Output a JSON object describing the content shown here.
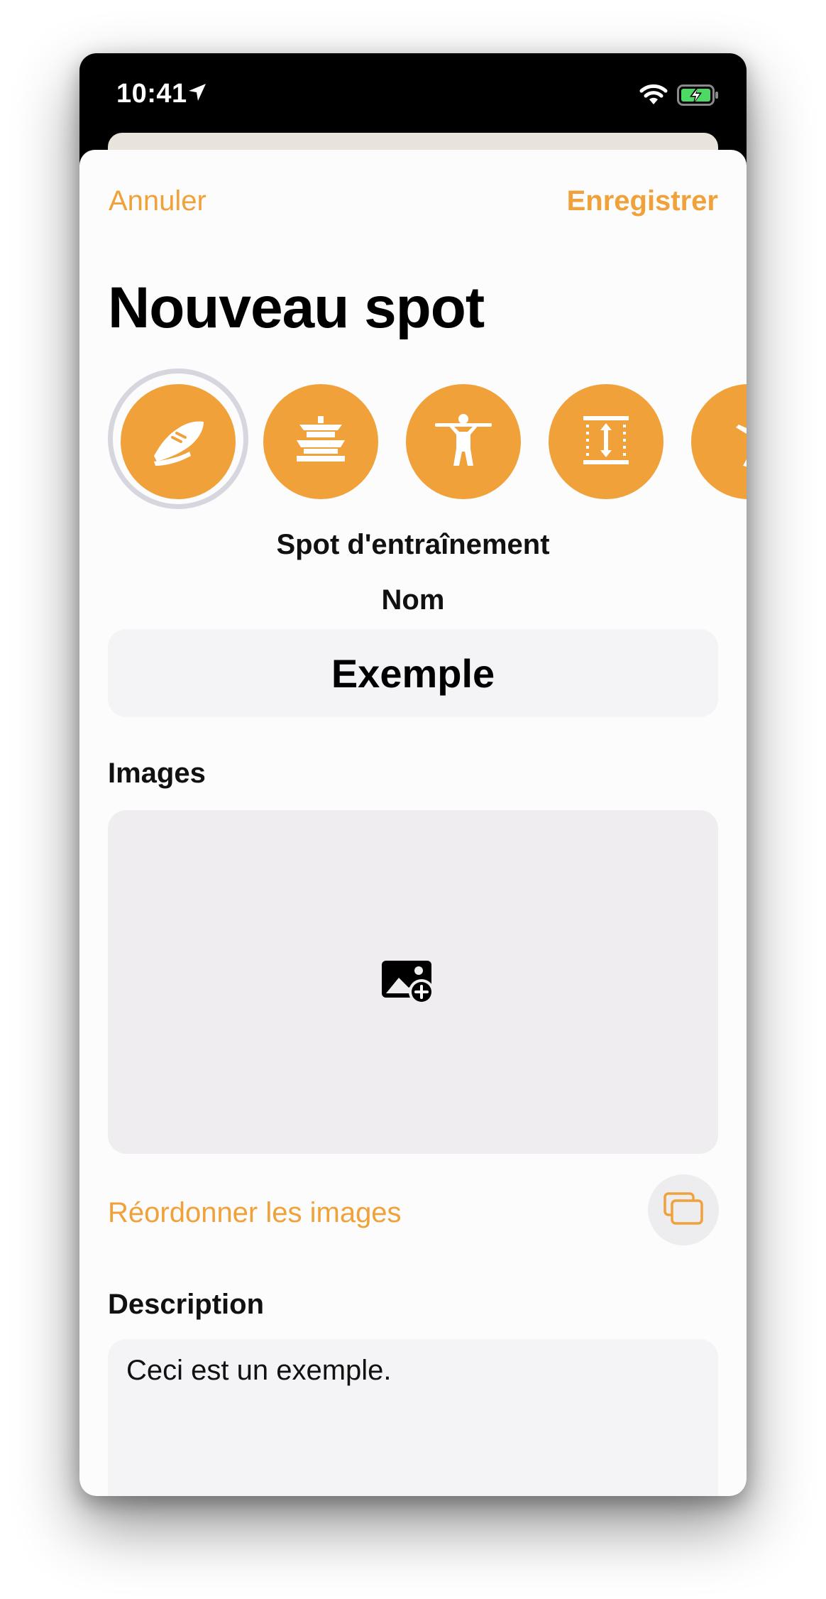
{
  "status_bar": {
    "time": "10:41",
    "icons": [
      "location-arrow-icon",
      "wifi-icon",
      "battery-charging-icon"
    ]
  },
  "nav": {
    "cancel_label": "Annuler",
    "save_label": "Enregistrer"
  },
  "page_title": "Nouveau spot",
  "spot_types": {
    "selected_index": 0,
    "selected_label": "Spot d'entraînement",
    "items": [
      "shoe-icon",
      "pagoda-icon",
      "pullup-bar-icon",
      "vertical-height-icon",
      "person-jumping-icon"
    ]
  },
  "name": {
    "label": "Nom",
    "value": "Exemple"
  },
  "images": {
    "label": "Images",
    "add_icon": "photo-add-icon"
  },
  "reorder": {
    "label": "Réordonner les images",
    "icon": "stacked-cards-icon"
  },
  "description": {
    "label": "Description",
    "value": "Ceci est un exemple."
  },
  "colors": {
    "accent": "#f0a13a",
    "sheet_background": "#fcfcfc",
    "field_background": "#f4f4f6",
    "images_background": "#efedf0",
    "selection_ring": "#d6d6de"
  }
}
